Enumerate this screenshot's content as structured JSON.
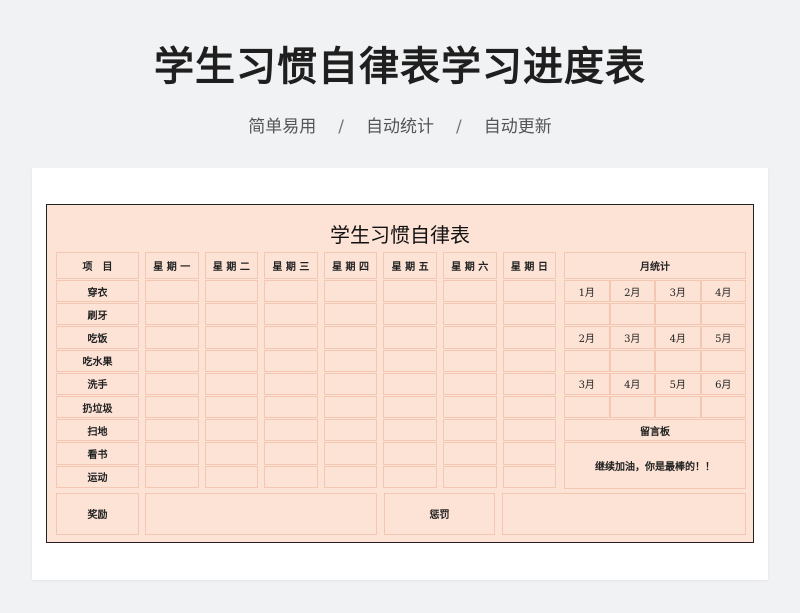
{
  "page": {
    "title": "学生习惯自律表学习进度表",
    "features": [
      "简单易用",
      "自动统计",
      "自动更新"
    ],
    "separator": "/"
  },
  "sheet": {
    "title": "学生习惯自律表",
    "item_header": "项　目",
    "weekdays": [
      "星 期 一",
      "星 期 二",
      "星 期 三",
      "星 期 四",
      "星 期 五",
      "星 期 六",
      "星 期 日"
    ],
    "items": [
      "穿衣",
      "刷牙",
      "吃饭",
      "吃水果",
      "洗手",
      "扔垃圾",
      "扫地",
      "看书",
      "运动"
    ],
    "monthly": {
      "header": "月统计",
      "rows": [
        [
          "1月",
          "2月",
          "3月",
          "4月"
        ],
        [
          "",
          "",
          "",
          ""
        ],
        [
          "2月",
          "3月",
          "4月",
          "5月"
        ],
        [
          "",
          "",
          "",
          ""
        ],
        [
          "3月",
          "4月",
          "5月",
          "6月"
        ],
        [
          "",
          "",
          "",
          ""
        ]
      ]
    },
    "message_board": {
      "label": "留言板",
      "text": "继续加油，你是最棒的！！"
    },
    "reward_label": "奖励",
    "punishment_label": "惩罚"
  }
}
